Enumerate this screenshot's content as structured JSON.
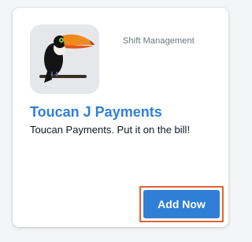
{
  "card": {
    "category": "Shift Management",
    "title": "Toucan J Payments",
    "description": "Toucan Payments. Put it on the bill!",
    "logo_icon": "toucan-logo-icon",
    "add_button_label": "Add Now"
  },
  "colors": {
    "accent": "#2f7fd6",
    "highlight_outline": "#e4632a",
    "logo_background": "#e5e7eb"
  }
}
